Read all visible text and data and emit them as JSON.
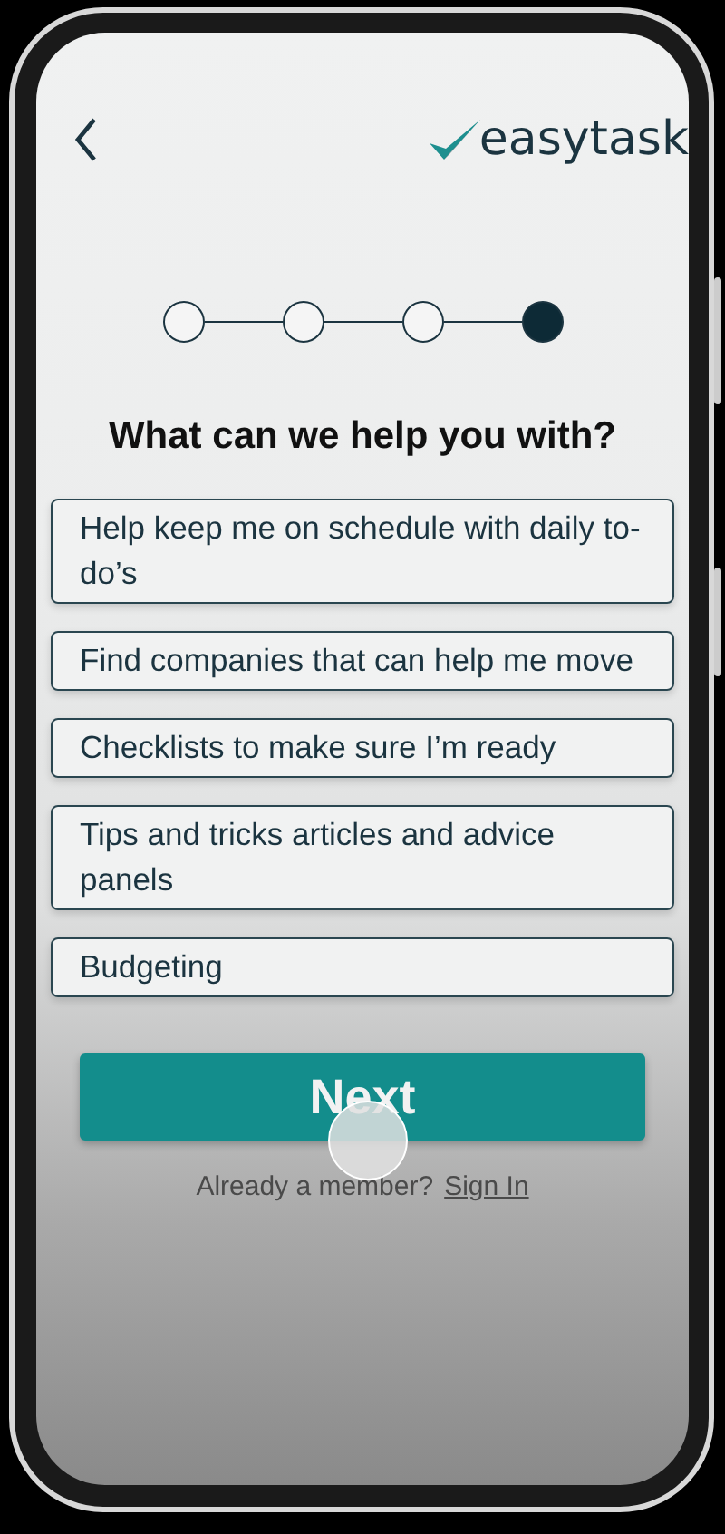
{
  "header": {
    "logo_text": "easytask"
  },
  "steps": [
    {
      "selected": false
    },
    {
      "selected": false
    },
    {
      "selected": false
    },
    {
      "selected": true
    }
  ],
  "heading": "What can we help you with?",
  "options": [
    "Help keep me on schedule with daily to- do’s",
    "Find companies that can help me move",
    "Checklists to make sure I’m ready",
    "Tips and tricks articles and advice panels",
    "Budgeting"
  ],
  "next_button": "Next",
  "footer": {
    "prompt": "Already a member?",
    "link": "Sign In"
  }
}
